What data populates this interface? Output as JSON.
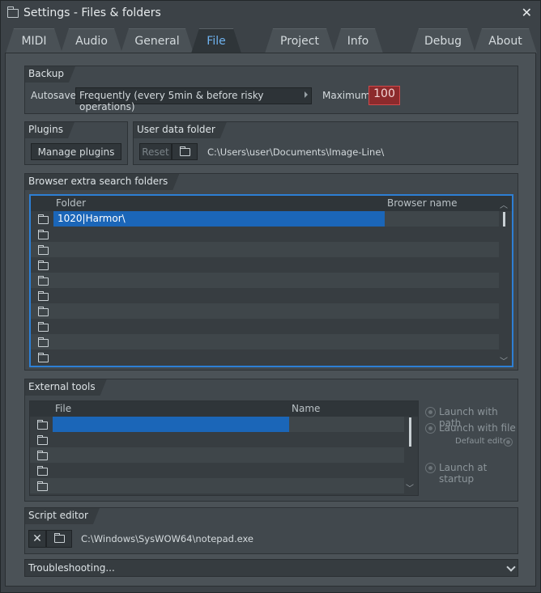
{
  "window": {
    "title": "Settings - Files & folders"
  },
  "tabs": [
    "MIDI",
    "Audio",
    "General",
    "File",
    "Project",
    "Info",
    "Debug",
    "About"
  ],
  "active_tab": "File",
  "backup": {
    "title": "Backup",
    "autosave_label": "Autosave",
    "autosave_value": "Frequently (every 5min & before risky operations)",
    "maximum_label": "Maximum",
    "maximum_value": "100"
  },
  "plugins": {
    "title": "Plugins",
    "manage_button": "Manage plugins"
  },
  "user_data": {
    "title": "User data folder",
    "reset_button": "Reset",
    "path": "C:\\Users\\user\\Documents\\Image-Line\\"
  },
  "browser_folders": {
    "title": "Browser extra search folders",
    "col_folder": "Folder",
    "col_name": "Browser name",
    "first_value": "1020|Harmor\\"
  },
  "external_tools": {
    "title": "External tools",
    "col_file": "File",
    "col_name": "Name",
    "launch_with_path": "Launch with path",
    "launch_with_file": "Launch with file",
    "default_editor": "Default editor",
    "launch_at_startup": "Launch at startup"
  },
  "script_editor": {
    "title": "Script editor",
    "path": "C:\\Windows\\SysWOW64\\notepad.exe"
  },
  "troubleshooting": {
    "label": "Troubleshooting..."
  },
  "colors": {
    "accent": "#2d7fd4",
    "selection": "#1b66b8",
    "active_tab_text": "#6fb3f0",
    "max_box": "#8c2a2c"
  }
}
